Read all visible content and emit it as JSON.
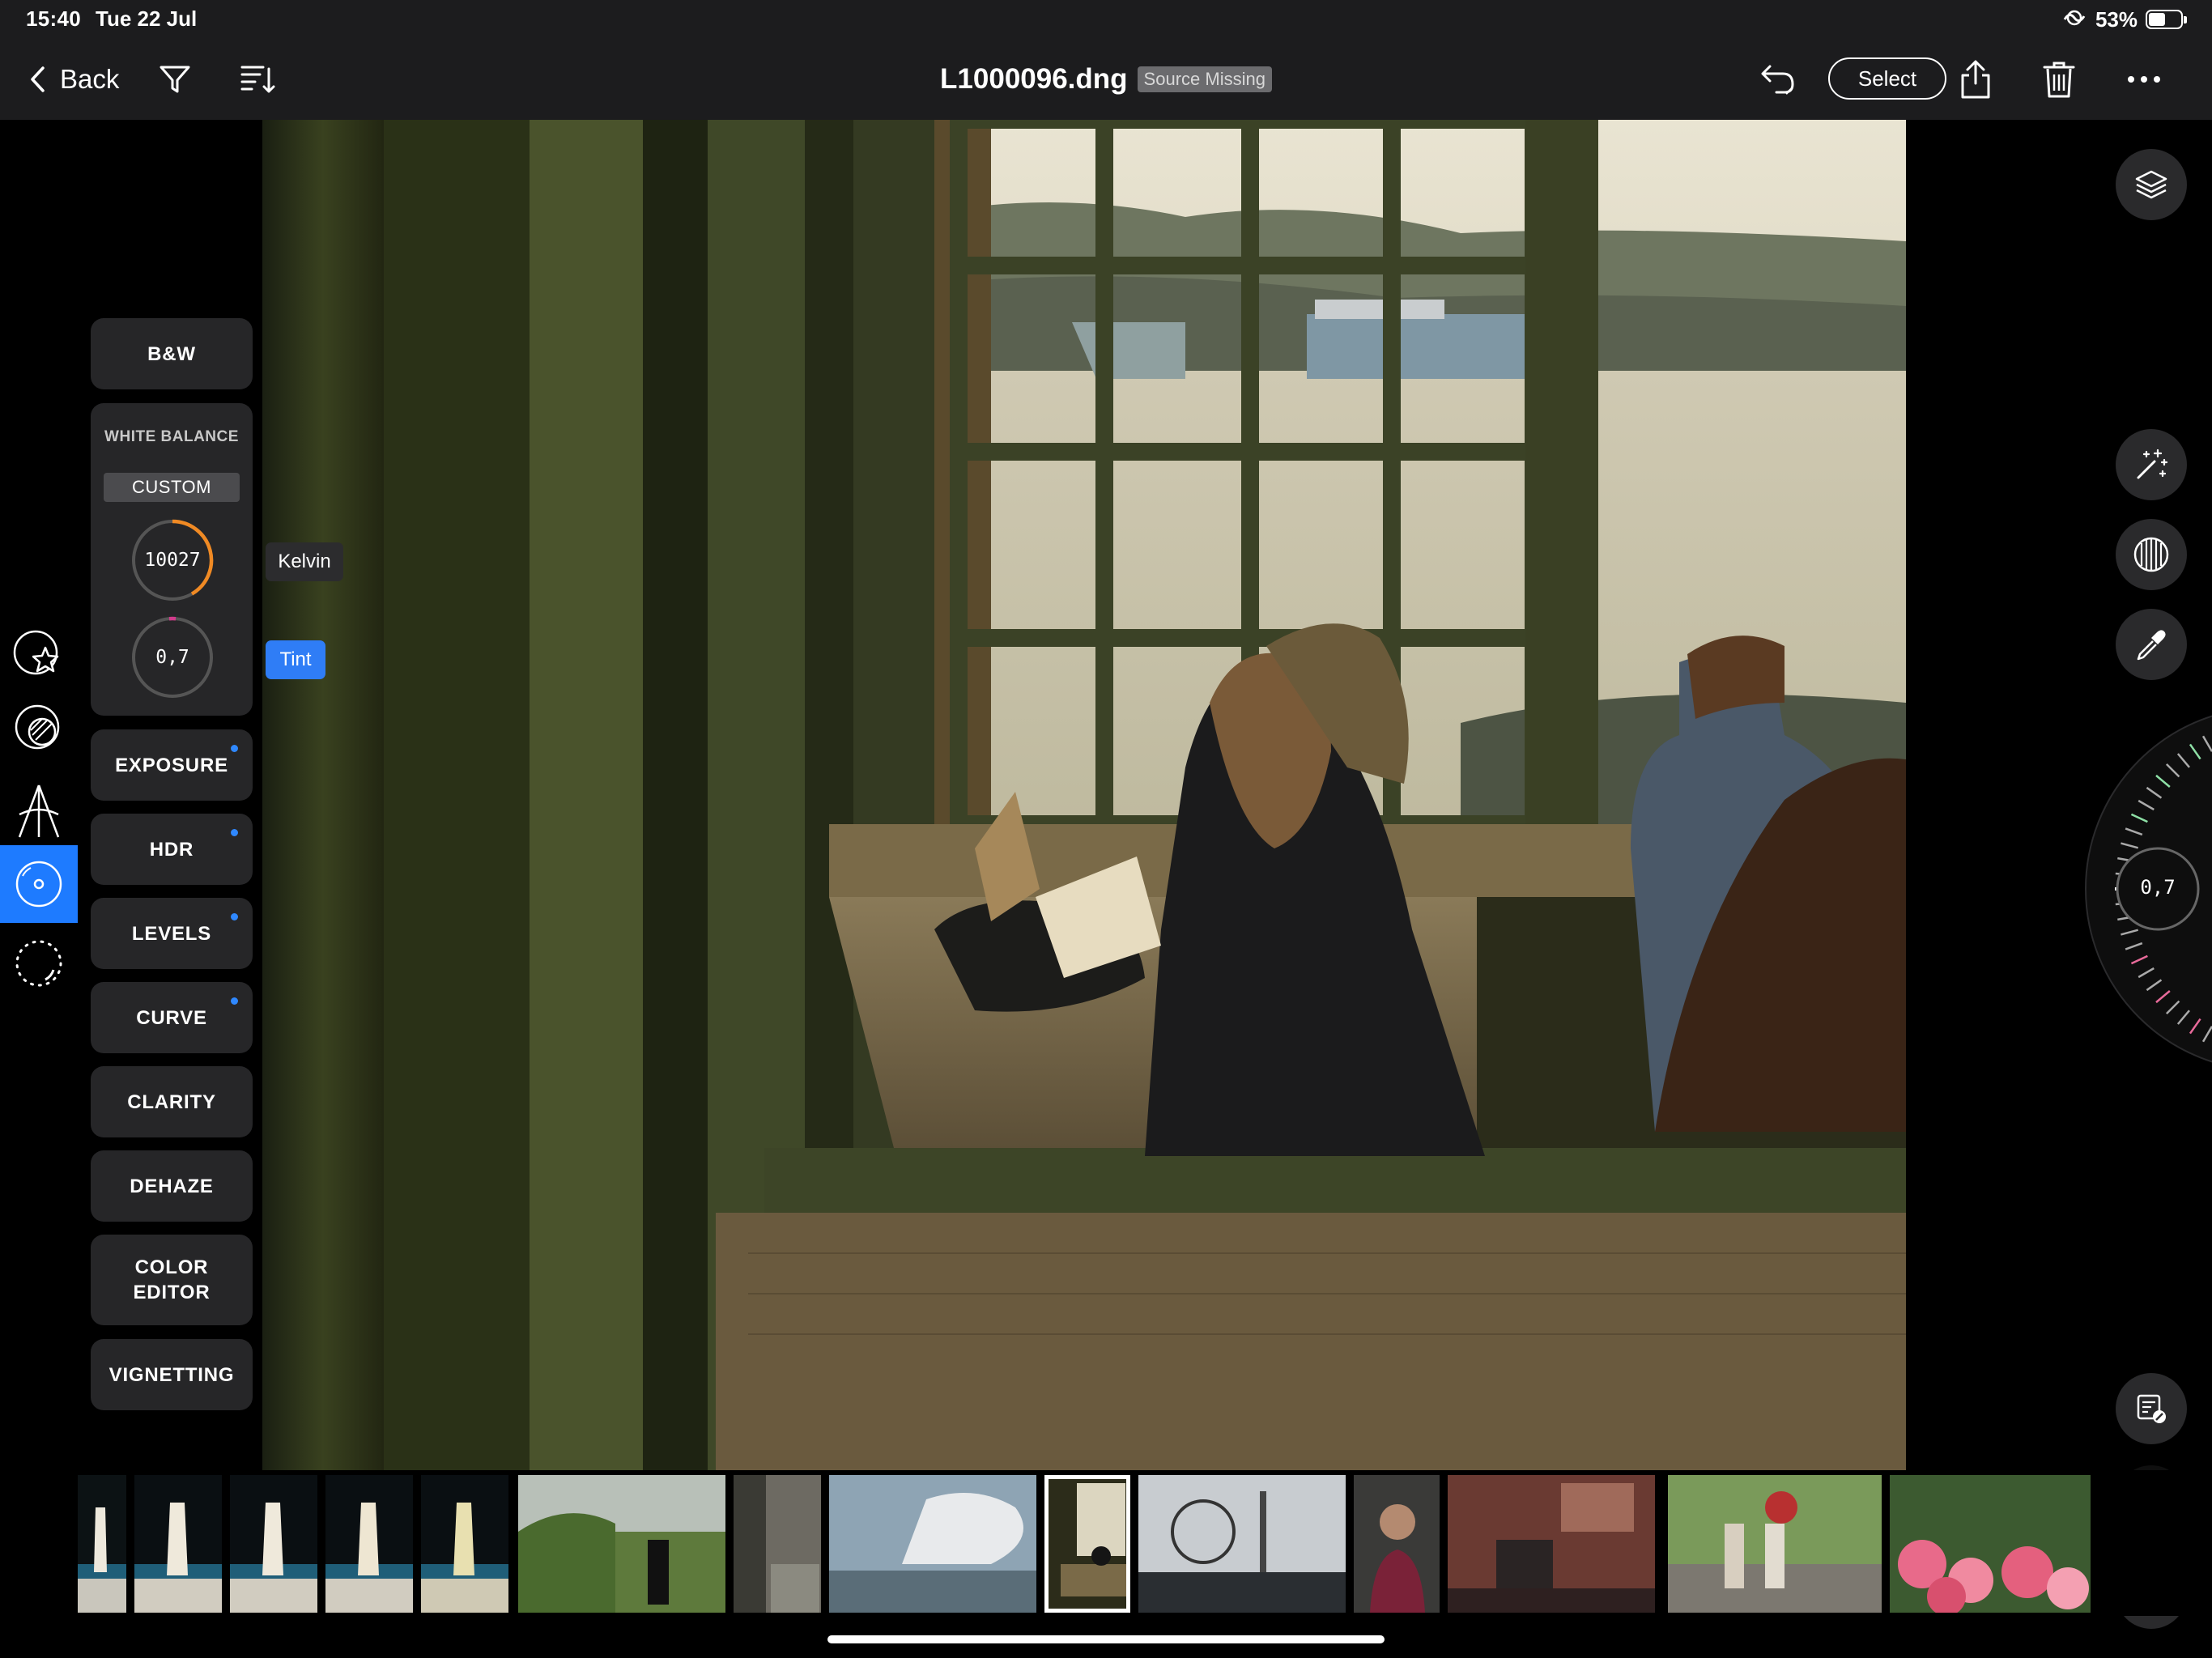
{
  "status_bar": {
    "time": "15:40",
    "date": "Tue 22 Jul",
    "battery": "53%",
    "battery_level": 0.53
  },
  "toolbar": {
    "back_label": "Back",
    "filename": "L1000096.dng",
    "source_badge": "Source Missing",
    "select_label": "Select",
    "icons": [
      "chevron-left-icon",
      "filter-icon",
      "sort-icon",
      "undo-icon",
      "share-icon",
      "trash-icon",
      "more-icon"
    ]
  },
  "left_rail": {
    "icons": [
      "star-presets-icon",
      "masking-icon",
      "geometry-icon",
      "adjust-icon",
      "selective-icon",
      "info-icon"
    ],
    "active": "adjust-icon"
  },
  "adjustments": {
    "bw_label": "B&W",
    "white_balance": {
      "title": "WHITE BALANCE",
      "mode": "CUSTOM",
      "kelvin_value": "10027",
      "tint_value": "0,7"
    },
    "buttons": [
      {
        "label": "EXPOSURE",
        "modified": true
      },
      {
        "label": "HDR",
        "modified": true
      },
      {
        "label": "LEVELS",
        "modified": true
      },
      {
        "label": "CURVE",
        "modified": true
      },
      {
        "label": "CLARITY",
        "modified": false
      },
      {
        "label": "DEHAZE",
        "modified": false
      },
      {
        "label": "COLOR\nEDITOR",
        "modified": false
      },
      {
        "label": "VIGNETTING",
        "modified": false
      }
    ]
  },
  "tooltips": {
    "kelvin": "Kelvin",
    "tint": "Tint"
  },
  "right_rail": {
    "icons": [
      "layers-icon",
      "auto-enhance-icon",
      "grain-icon",
      "eyedropper-icon",
      "copy-settings-icon",
      "paste-settings-icon",
      "export-icon"
    ]
  },
  "dial": {
    "value": "0,7"
  },
  "colors": {
    "accent": "#1e7bff",
    "kelvin_ring": "#f08a24",
    "tint_ring": "#d23b8c",
    "panel": "#262628",
    "toolbar": "#1c1c1e"
  },
  "filmstrip": {
    "count": 13,
    "selected_index": 8
  }
}
